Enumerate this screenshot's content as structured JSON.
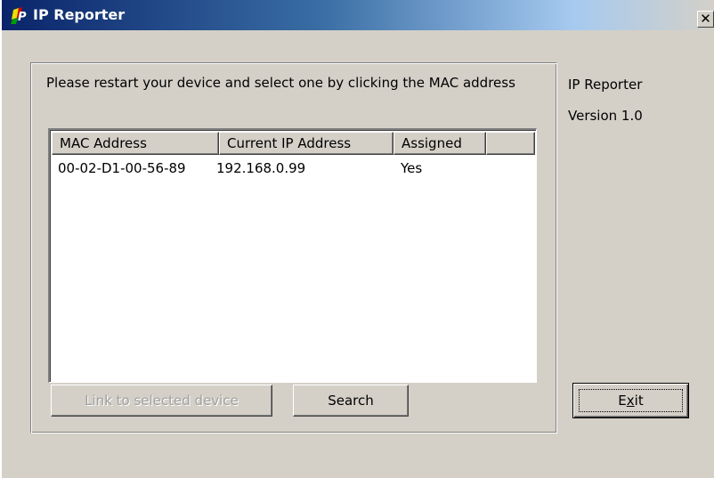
{
  "window": {
    "title": "IP Reporter",
    "close_glyph": "✕"
  },
  "instruction": "Please restart your device and select one by clicking the MAC address",
  "device_list": {
    "columns": [
      "MAC Address",
      "Current IP Address",
      "Assigned"
    ],
    "rows": [
      {
        "mac": "00-02-D1-00-56-89",
        "ip": "192.168.0.99",
        "assigned": "Yes"
      }
    ]
  },
  "buttons": {
    "link_label": "Link to selected device",
    "search_label": "Search",
    "exit_prefix": "E",
    "exit_mnemonic": "x",
    "exit_suffix": "it"
  },
  "side_info": {
    "app_name": "IP Reporter",
    "version": "Version 1.0"
  },
  "colors": {
    "title_bar_start": "#0a246a",
    "face": "#d4d0c8"
  },
  "icons": {
    "app": "ip-logo-icon",
    "close": "close-icon"
  }
}
